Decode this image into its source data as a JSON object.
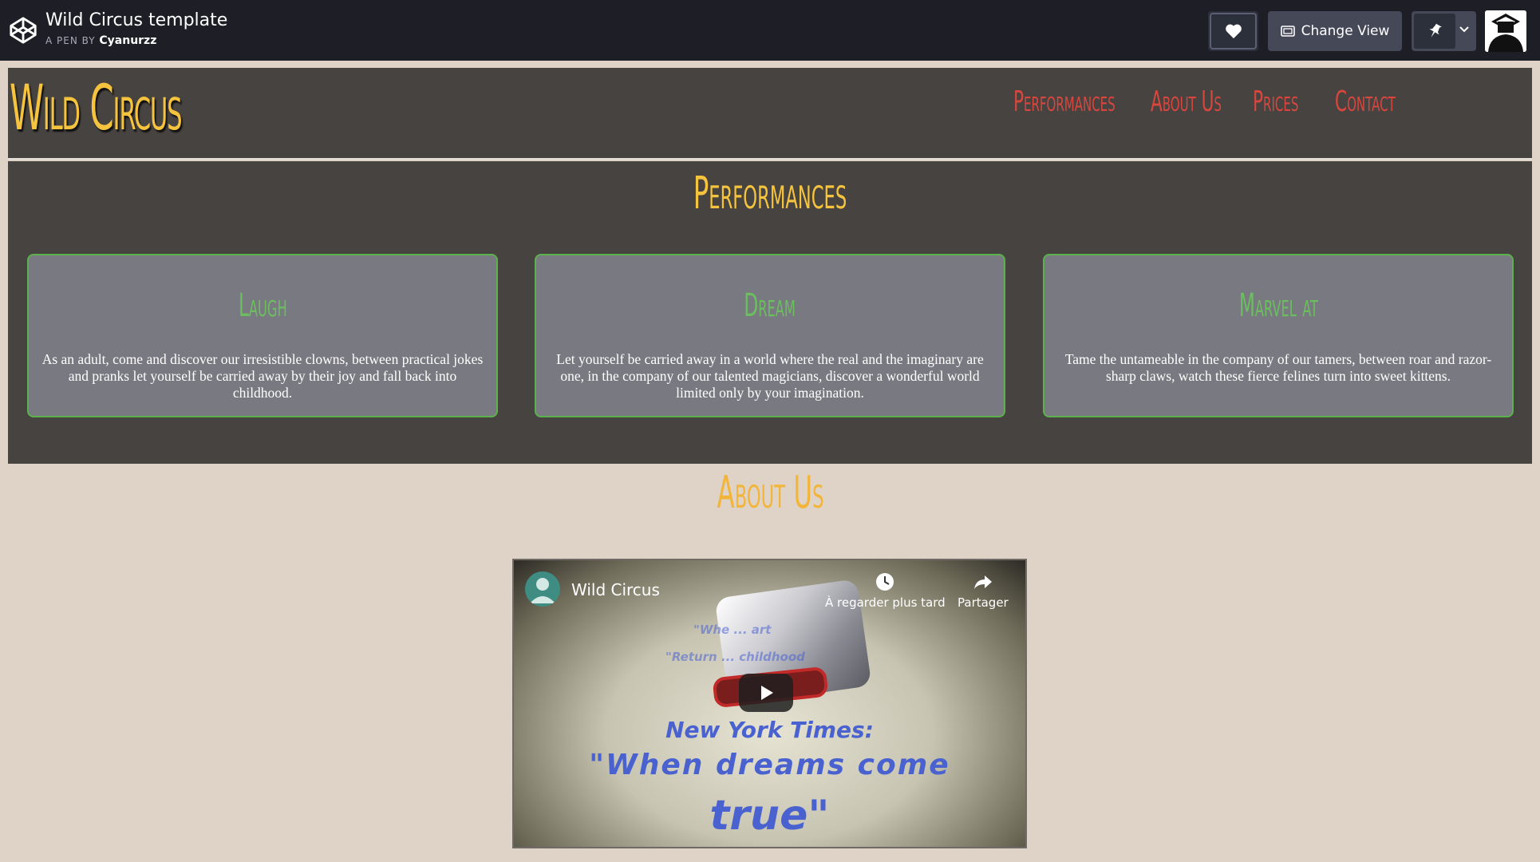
{
  "codepen": {
    "title": "Wild Circus template",
    "byline": "A PEN BY",
    "author": "Cyanurzz",
    "change_view_label": "Change View"
  },
  "site": {
    "brand": "Wild Circus",
    "nav": [
      "Performances",
      "About Us",
      "Prices",
      "Contact"
    ]
  },
  "performances": {
    "title": "Performances",
    "cards": [
      {
        "title": "Laugh",
        "text": "As an adult, come and discover our irresistible clowns, between practical jokes and pranks let yourself be carried away by their joy and fall back into childhood."
      },
      {
        "title": "Dream",
        "text": "Let yourself be carried away in a world where the real and the imaginary are one, in the company of our talented magicians, discover a wonderful world limited only by your imagination."
      },
      {
        "title": "Marvel at",
        "text": "Tame the untameable in the company of our tamers, between roar and razor-sharp claws, watch these fierce felines turn into sweet kittens."
      }
    ]
  },
  "about": {
    "title": "About Us",
    "video": {
      "channel": "Wild Circus",
      "watch_later": "À regarder plus tard",
      "share": "Partager",
      "quote_line1": "New York Times:",
      "quote_line2": "\"When dreams come",
      "quote_line3": "true\""
    }
  },
  "colors": {
    "accent_gold": "#f5c33d",
    "nav_red": "#d9463e",
    "card_green": "#5bb24d",
    "panel_dark": "#474341",
    "page_beige": "#ded3c6"
  }
}
